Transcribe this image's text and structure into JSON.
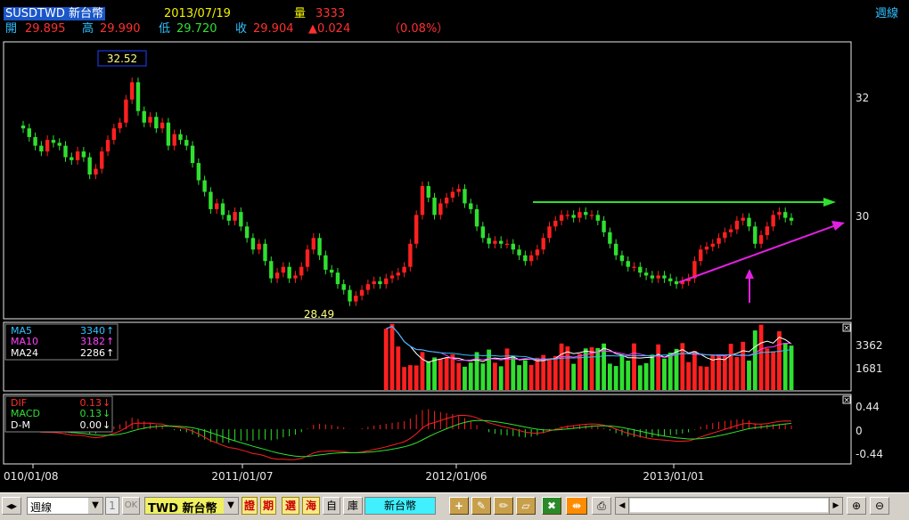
{
  "header": {
    "symbol": "SUSDTWD 新台幣",
    "date": "2013/07/19",
    "volume_label": "量",
    "volume_value": "3333",
    "period": "週線",
    "open_label": "開",
    "open": "29.895",
    "high_label": "高",
    "high": "29.990",
    "low_label": "低",
    "low": "29.720",
    "close_label": "收",
    "close": "29.904",
    "change": "▲0.024",
    "change_pct": "（0.08%）"
  },
  "colors": {
    "up": "#ff2020",
    "down": "#30e030",
    "ma5": "#ffffff",
    "ma10": "#ff40ff",
    "ma24": "#30c0ff",
    "trend_flat": "#30e030",
    "trend_up": "#e020e0"
  },
  "chart_data": [
    {
      "type": "candlestick",
      "title": "SUSDTWD 新台幣 週線",
      "x_ticks": [
        "010/01/08",
        "2011/01/07",
        "2012/01/06",
        "2013/01/01"
      ],
      "y_ticks": [
        "32",
        "30"
      ],
      "ylim": [
        28.2,
        33.0
      ],
      "annotations": {
        "max": "32.52",
        "min": "28.49"
      },
      "series": [
        {
          "values": [
            31.5,
            31.35,
            31.2,
            31.1,
            31.3,
            31.25,
            31.2,
            31.0,
            30.95,
            31.1,
            31.0,
            30.7,
            30.8,
            31.1,
            31.3,
            31.5,
            31.6,
            32.0,
            32.3,
            31.8,
            31.6,
            31.7,
            31.5,
            31.6,
            31.2,
            31.4,
            31.3,
            31.2,
            30.9,
            30.6,
            30.4,
            30.1,
            30.2,
            30.0,
            29.9,
            30.05,
            29.8,
            29.6,
            29.4,
            29.5,
            29.2,
            28.9,
            29.0,
            29.1,
            28.9,
            28.95,
            29.1,
            29.4,
            29.6,
            29.3,
            29.05,
            29.0,
            28.8,
            28.7,
            28.5,
            28.6,
            28.7,
            28.8,
            28.85,
            28.8,
            28.9,
            28.95,
            29.0,
            29.1,
            29.5,
            30.0,
            30.5,
            30.3,
            30.0,
            30.2,
            30.3,
            30.4,
            30.45,
            30.2,
            30.1,
            29.8,
            29.6,
            29.5,
            29.55,
            29.5,
            29.5,
            29.4,
            29.3,
            29.2,
            29.3,
            29.4,
            29.6,
            29.8,
            29.9,
            30.0,
            30.0,
            29.95,
            30.05,
            30.0,
            30.0,
            29.9,
            29.7,
            29.5,
            29.3,
            29.2,
            29.1,
            29.1,
            29.0,
            28.95,
            28.9,
            28.95,
            28.9,
            28.85,
            28.8,
            28.85,
            28.9,
            29.2,
            29.4,
            29.45,
            29.5,
            29.6,
            29.7,
            29.75,
            29.9,
            29.95,
            29.8,
            29.5,
            29.65,
            29.8,
            30.0,
            30.05,
            29.95,
            29.9
          ]
        }
      ]
    },
    {
      "type": "bar",
      "title": "Volume",
      "legend": [
        {
          "name": "MA5",
          "value": "3340",
          "arrow": "↑"
        },
        {
          "name": "MA10",
          "value": "3182",
          "arrow": "↑"
        },
        {
          "name": "MA24",
          "value": "2286",
          "arrow": "↑"
        }
      ],
      "y_ticks": [
        "3362",
        "1681"
      ],
      "ylim": [
        0,
        4200
      ]
    },
    {
      "type": "line",
      "title": "MACD",
      "legend": [
        {
          "name": "DIF",
          "value": "0.13",
          "arrow": "↓"
        },
        {
          "name": "MACD",
          "value": "0.13",
          "arrow": "↓"
        },
        {
          "name": "D-M",
          "value": "0.00",
          "arrow": "↓"
        }
      ],
      "y_ticks": [
        "0.44",
        "0",
        "-0.44"
      ],
      "ylim": [
        -0.6,
        0.6
      ]
    }
  ],
  "toolbar": {
    "period_select": "週線",
    "count_value": "1",
    "ok_label": "OK",
    "symbol_select": "TWD 新台幣",
    "btn_zheng": "證",
    "btn_qi": "期",
    "btn_xuan": "選",
    "btn_hai": "海",
    "btn_zi": "自",
    "btn_ku": "庫",
    "current_symbol": "新台幣"
  }
}
